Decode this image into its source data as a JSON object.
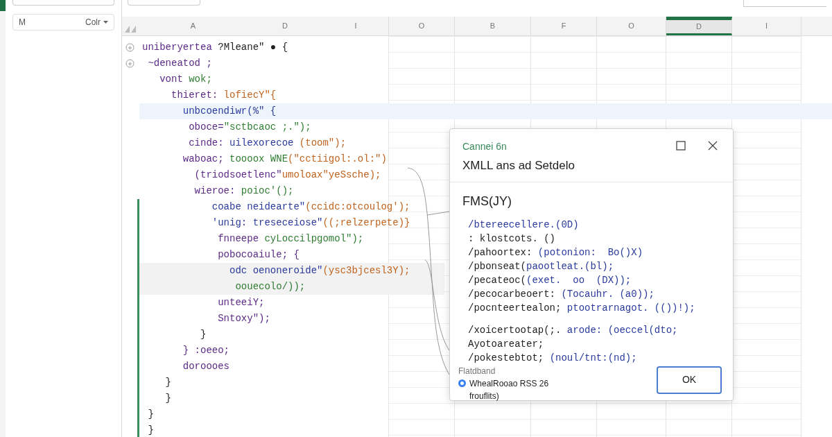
{
  "sidebar": {
    "filter": {
      "value": "M",
      "option": "Colr"
    }
  },
  "columns": [
    {
      "label": "A",
      "selected": false
    },
    {
      "label": "D",
      "selected": false
    },
    {
      "label": "I",
      "selected": false
    },
    {
      "label": "O",
      "selected": false
    },
    {
      "label": "B",
      "selected": false
    },
    {
      "label": "F",
      "selected": false
    },
    {
      "label": "O",
      "selected": false
    },
    {
      "label": "D",
      "selected": true
    },
    {
      "label": "I",
      "selected": false
    }
  ],
  "code_lines": [
    {
      "segments": [
        {
          "text": "uniberyertea",
          "color": "#5b2a86"
        },
        {
          "text": " ?Mleane\" ● {",
          "color": "#222222"
        }
      ],
      "marker": true,
      "changed": false,
      "selected": false,
      "hovered": false
    },
    {
      "segments": [
        {
          "text": " ~deneatod ;",
          "color": "#5b2a86"
        }
      ],
      "marker": true,
      "changed": false,
      "selected": false,
      "hovered": false
    },
    {
      "segments": [
        {
          "text": "   vont",
          "color": "#5b2a86"
        },
        {
          "text": " wok;",
          "color": "#2e7d32"
        }
      ],
      "marker": false,
      "changed": false,
      "selected": false,
      "hovered": false
    },
    {
      "segments": [
        {
          "text": "     thieret:",
          "color": "#5b2a86"
        },
        {
          "text": " lofiecY\"{",
          "color": "#c0631e"
        }
      ],
      "marker": false,
      "changed": false,
      "selected": false,
      "hovered": false
    },
    {
      "segments": [
        {
          "text": "       unbcoendiwr(%\" {",
          "color": "#2a3a9c"
        }
      ],
      "marker": false,
      "changed": false,
      "selected": true,
      "hovered": false
    },
    {
      "segments": [
        {
          "text": "        oboce=",
          "color": "#5b2a86"
        },
        {
          "text": "\"sctbcaoc ;.\");",
          "color": "#2e7d32"
        }
      ],
      "marker": false,
      "changed": false,
      "selected": false,
      "hovered": false
    },
    {
      "segments": [
        {
          "text": "        cinde:",
          "color": "#5b2a86"
        },
        {
          "text": " uilexorecoe",
          "color": "#2a3a9c"
        },
        {
          "text": " (toom\");",
          "color": "#c0631e"
        }
      ],
      "marker": false,
      "changed": false,
      "selected": false,
      "hovered": false
    },
    {
      "segments": [
        {
          "text": "       waboac;",
          "color": "#5b2a86"
        },
        {
          "text": " toooox WNE",
          "color": "#2e7d32"
        },
        {
          "text": "(\"cctiigol:.ol:\")",
          "color": "#c0631e"
        }
      ],
      "marker": false,
      "changed": false,
      "selected": false,
      "hovered": false
    },
    {
      "segments": [
        {
          "text": "         (triodsoetlenc\"",
          "color": "#5b2a86"
        },
        {
          "text": "umoloax\"yeSsche);",
          "color": "#c0631e"
        }
      ],
      "marker": false,
      "changed": false,
      "selected": false,
      "hovered": false
    },
    {
      "segments": [
        {
          "text": "         wieroe:",
          "color": "#5b2a86"
        },
        {
          "text": " poioc'();",
          "color": "#2e7d32"
        }
      ],
      "marker": false,
      "changed": false,
      "selected": false,
      "hovered": false
    },
    {
      "segments": [
        {
          "text": "            coabe neidearte\"",
          "color": "#2a3a9c"
        },
        {
          "text": "(ccidc:otcoulog');",
          "color": "#c0631e"
        }
      ],
      "marker": false,
      "changed": true,
      "selected": false,
      "hovered": false
    },
    {
      "segments": [
        {
          "text": "            'unig: treseceiose\"",
          "color": "#2a3a9c"
        },
        {
          "text": "((;relzerpete)}",
          "color": "#c0631e"
        }
      ],
      "marker": false,
      "changed": true,
      "selected": false,
      "hovered": false
    },
    {
      "segments": [
        {
          "text": "             fnneepe",
          "color": "#5b2a86"
        },
        {
          "text": " cyLoccilpgomol\");",
          "color": "#2e7d32"
        }
      ],
      "marker": false,
      "changed": true,
      "selected": false,
      "hovered": false
    },
    {
      "segments": [
        {
          "text": "             pobocoaiule; {",
          "color": "#5b2a86"
        }
      ],
      "marker": false,
      "changed": true,
      "selected": false,
      "hovered": false
    },
    {
      "segments": [
        {
          "text": "               odc oenoneroide\"",
          "color": "#2a3a9c"
        },
        {
          "text": "(ysc3bjcesl3Y);",
          "color": "#c0631e"
        }
      ],
      "marker": false,
      "changed": true,
      "selected": false,
      "hovered": true
    },
    {
      "segments": [
        {
          "text": "                oouecolo/));",
          "color": "#2e7d32"
        }
      ],
      "marker": false,
      "changed": true,
      "selected": false,
      "hovered": true
    },
    {
      "segments": [
        {
          "text": "             unteeiY;",
          "color": "#5b2a86"
        }
      ],
      "marker": false,
      "changed": true,
      "selected": false,
      "hovered": false
    },
    {
      "segments": [
        {
          "text": "             Sntoxy\");",
          "color": "#5b2a86"
        }
      ],
      "marker": false,
      "changed": true,
      "selected": false,
      "hovered": false
    },
    {
      "segments": [
        {
          "text": "          }",
          "color": "#222222"
        }
      ],
      "marker": false,
      "changed": true,
      "selected": false,
      "hovered": false
    },
    {
      "segments": [
        {
          "text": "       } :oeeo;",
          "color": "#5b2a86"
        }
      ],
      "marker": false,
      "changed": true,
      "selected": false,
      "hovered": false
    },
    {
      "segments": [
        {
          "text": "       doroooes",
          "color": "#5b2a86"
        }
      ],
      "marker": false,
      "changed": true,
      "selected": false,
      "hovered": false
    },
    {
      "segments": [
        {
          "text": "    }",
          "color": "#222222"
        }
      ],
      "marker": false,
      "changed": true,
      "selected": false,
      "hovered": false
    },
    {
      "segments": [
        {
          "text": "    }",
          "color": "#222222"
        }
      ],
      "marker": false,
      "changed": true,
      "selected": false,
      "hovered": false
    },
    {
      "segments": [
        {
          "text": " }",
          "color": "#222222"
        }
      ],
      "marker": false,
      "changed": true,
      "selected": false,
      "hovered": false
    },
    {
      "segments": [
        {
          "text": " }",
          "color": "#222222"
        }
      ],
      "marker": false,
      "changed": true,
      "selected": false,
      "hovered": false
    }
  ],
  "dialog": {
    "subtitle": "Cannei 6n",
    "title": "XMLL ans ad Setdelo",
    "heading": "FMS(JY)",
    "lines": [
      [
        {
          "text": "/btereecellere.(0D)",
          "color": "#2a3a9c"
        }
      ],
      [
        {
          "text": ": klostcots. ()",
          "color": "#222222"
        }
      ],
      [
        {
          "text": "/pahoortex: ",
          "color": "#222222"
        },
        {
          "text": "(potonion:  Bo()X)",
          "color": "#2a3a9c"
        }
      ],
      [
        {
          "text": "/pbonseat(",
          "color": "#222222"
        },
        {
          "text": "paootleat.(bl);",
          "color": "#2a3a9c"
        }
      ],
      [
        {
          "text": "/pecateoc(",
          "color": "#222222"
        },
        {
          "text": "(exet.  oo  (DX));",
          "color": "#2a3a9c"
        }
      ],
      [
        {
          "text": "/pecocarbeoert: ",
          "color": "#222222"
        },
        {
          "text": "(Tocauhr. (a0));",
          "color": "#2a3a9c"
        }
      ],
      [
        {
          "text": "/pocnteertealon; ",
          "color": "#222222"
        },
        {
          "text": "ptootrarnagot. (())!);",
          "color": "#2a3a9c"
        }
      ]
    ],
    "lines_2": [
      [
        {
          "text": "/xoicertootap(;. ",
          "color": "#222222"
        },
        {
          "text": "arode: (oeccel(dto;",
          "color": "#2a3a9c"
        }
      ],
      [
        {
          "text": "Ayotoareater;",
          "color": "#222222"
        }
      ],
      [
        {
          "text": "/pokestebtot; ",
          "color": "#222222"
        },
        {
          "text": "(noul/tnt:(nd);",
          "color": "#2a3a9c"
        }
      ]
    ],
    "group_label": "Flatdband",
    "option": {
      "label": "WhealRooao RSS 26",
      "selected": true
    },
    "option_note": "frouflits)",
    "ok": "OK"
  }
}
